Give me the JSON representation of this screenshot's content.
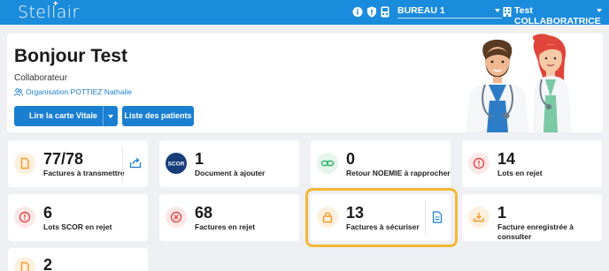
{
  "topbar": {
    "logo": "Stellair",
    "workspace": "BUREAU 1",
    "user": "Test COLLABORATRICE"
  },
  "welcome": {
    "greeting": "Bonjour Test",
    "role": "Collaborateur",
    "organisation": "Organisation POTTIEZ Nathalie",
    "read_card_button": "Lire la carte Vitale",
    "patients_button": "Liste des patients"
  },
  "cards": [
    {
      "value": "77/78",
      "label": "Factures à transmettre",
      "icon": "document-icon",
      "color": "#f49a2a"
    },
    {
      "value": "1",
      "label": "Document à ajouter",
      "icon": "scor-logo"
    },
    {
      "value": "0",
      "label": "Retour NOEMIE à rapprocher",
      "icon": "link-icon",
      "color": "#34b36a"
    },
    {
      "value": "14",
      "label": "Lots en rejet",
      "icon": "alert-circle-icon",
      "color": "#e24b4b"
    },
    {
      "value": "6",
      "label": "Lots SCOR en rejet",
      "icon": "alert-circle-icon",
      "color": "#e24b4b"
    },
    {
      "value": "68",
      "label": "Factures en rejet",
      "icon": "close-circle-icon",
      "color": "#e24b4b"
    },
    {
      "value": "13",
      "label": "Factures à sécuriser",
      "icon": "lock-icon",
      "color": "#f49a2a"
    },
    {
      "value": "1",
      "label": "Facture enregistrée à consulter",
      "icon": "download-icon",
      "color": "#f49a2a"
    },
    {
      "value": "2",
      "label": "",
      "icon": "document-icon",
      "color": "#f49a2a"
    }
  ],
  "accent": "#1b7fd1",
  "highlight": "#f4b836"
}
